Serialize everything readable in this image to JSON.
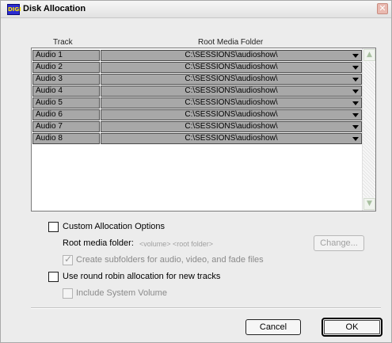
{
  "window": {
    "title": "Disk Allocation",
    "app_icon_text": "DIGI",
    "close_glyph": "✕"
  },
  "table": {
    "headers": {
      "track": "Track",
      "folder": "Root Media Folder"
    },
    "rows": [
      {
        "track": "Audio 1",
        "folder": "C:\\SESSIONS\\audioshow\\"
      },
      {
        "track": "Audio 2",
        "folder": "C:\\SESSIONS\\audioshow\\"
      },
      {
        "track": "Audio 3",
        "folder": "C:\\SESSIONS\\audioshow\\"
      },
      {
        "track": "Audio 4",
        "folder": "C:\\SESSIONS\\audioshow\\"
      },
      {
        "track": "Audio 5",
        "folder": "C:\\SESSIONS\\audioshow\\"
      },
      {
        "track": "Audio 6",
        "folder": "C:\\SESSIONS\\audioshow\\"
      },
      {
        "track": "Audio 7",
        "folder": "C:\\SESSIONS\\audioshow\\"
      },
      {
        "track": "Audio 8",
        "folder": "C:\\SESSIONS\\audioshow\\"
      }
    ],
    "scroll_up_glyph": "▲",
    "scroll_down_glyph": "▼"
  },
  "options": {
    "custom_allocation": {
      "label": "Custom Allocation Options",
      "checked": false
    },
    "root_media_folder": {
      "label": "Root media folder:",
      "value": "<volume> <root folder>"
    },
    "change_button": "Change...",
    "create_subfolders": {
      "label": "Create subfolders for audio, video, and fade files",
      "checked": true,
      "check_glyph": "✓"
    },
    "round_robin": {
      "label": "Use round robin allocation for new tracks",
      "checked": false
    },
    "include_system_volume": {
      "label": "Include System Volume",
      "checked": false
    }
  },
  "buttons": {
    "cancel": "Cancel",
    "ok": "OK"
  },
  "colors": {
    "row_fill": "#a8a8a8",
    "dialog_bg": "#ececec",
    "app_icon_bg": "#2b2bd0"
  }
}
